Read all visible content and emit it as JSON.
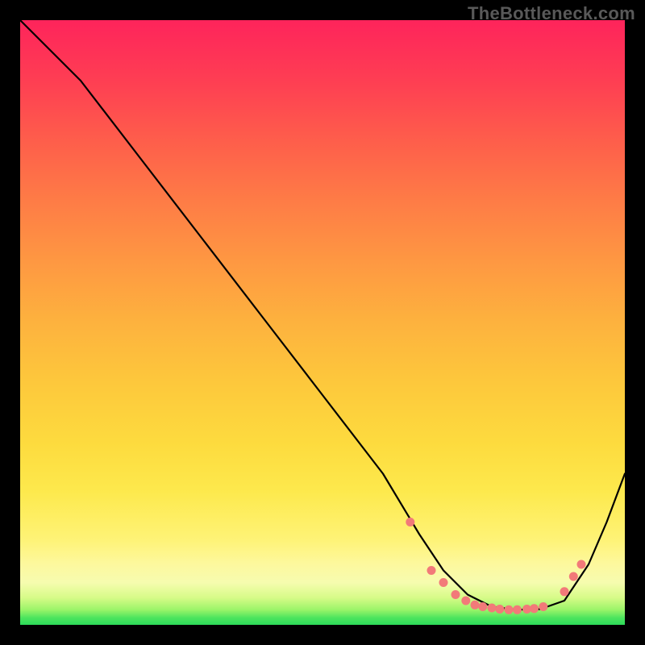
{
  "watermark": "TheBottleneck.com",
  "chart_data": {
    "type": "line",
    "title": "",
    "xlabel": "",
    "ylabel": "",
    "xlim": [
      0,
      100
    ],
    "ylim": [
      0,
      100
    ],
    "grid": false,
    "legend": false,
    "series": [
      {
        "name": "bottleneck-curve",
        "x": [
          0,
          4,
          10,
          20,
          30,
          40,
          50,
          60,
          66,
          70,
          74,
          78,
          82,
          86,
          90,
          94,
          97,
          100
        ],
        "y": [
          100,
          96,
          90,
          77,
          64,
          51,
          38,
          25,
          15,
          9,
          5,
          3,
          2.5,
          2.6,
          4,
          10,
          17,
          25
        ]
      }
    ],
    "markers": {
      "name": "highlight-dots",
      "x": [
        64.5,
        68,
        70,
        72,
        73.7,
        75.2,
        76.5,
        78,
        79.3,
        80.8,
        82.2,
        83.8,
        85,
        86.5,
        90,
        91.5,
        92.8
      ],
      "y": [
        17,
        9,
        7,
        5,
        4,
        3.3,
        3,
        2.8,
        2.6,
        2.5,
        2.5,
        2.6,
        2.7,
        3,
        5.5,
        8,
        10
      ]
    },
    "gradient_stops": [
      {
        "pos": 0,
        "color": "#2CDB5A"
      },
      {
        "pos": 7,
        "color": "#F6FCAF"
      },
      {
        "pos": 22,
        "color": "#FDE94D"
      },
      {
        "pos": 50,
        "color": "#FDB23E"
      },
      {
        "pos": 80,
        "color": "#FE5E4B"
      },
      {
        "pos": 100,
        "color": "#FE245B"
      }
    ]
  }
}
